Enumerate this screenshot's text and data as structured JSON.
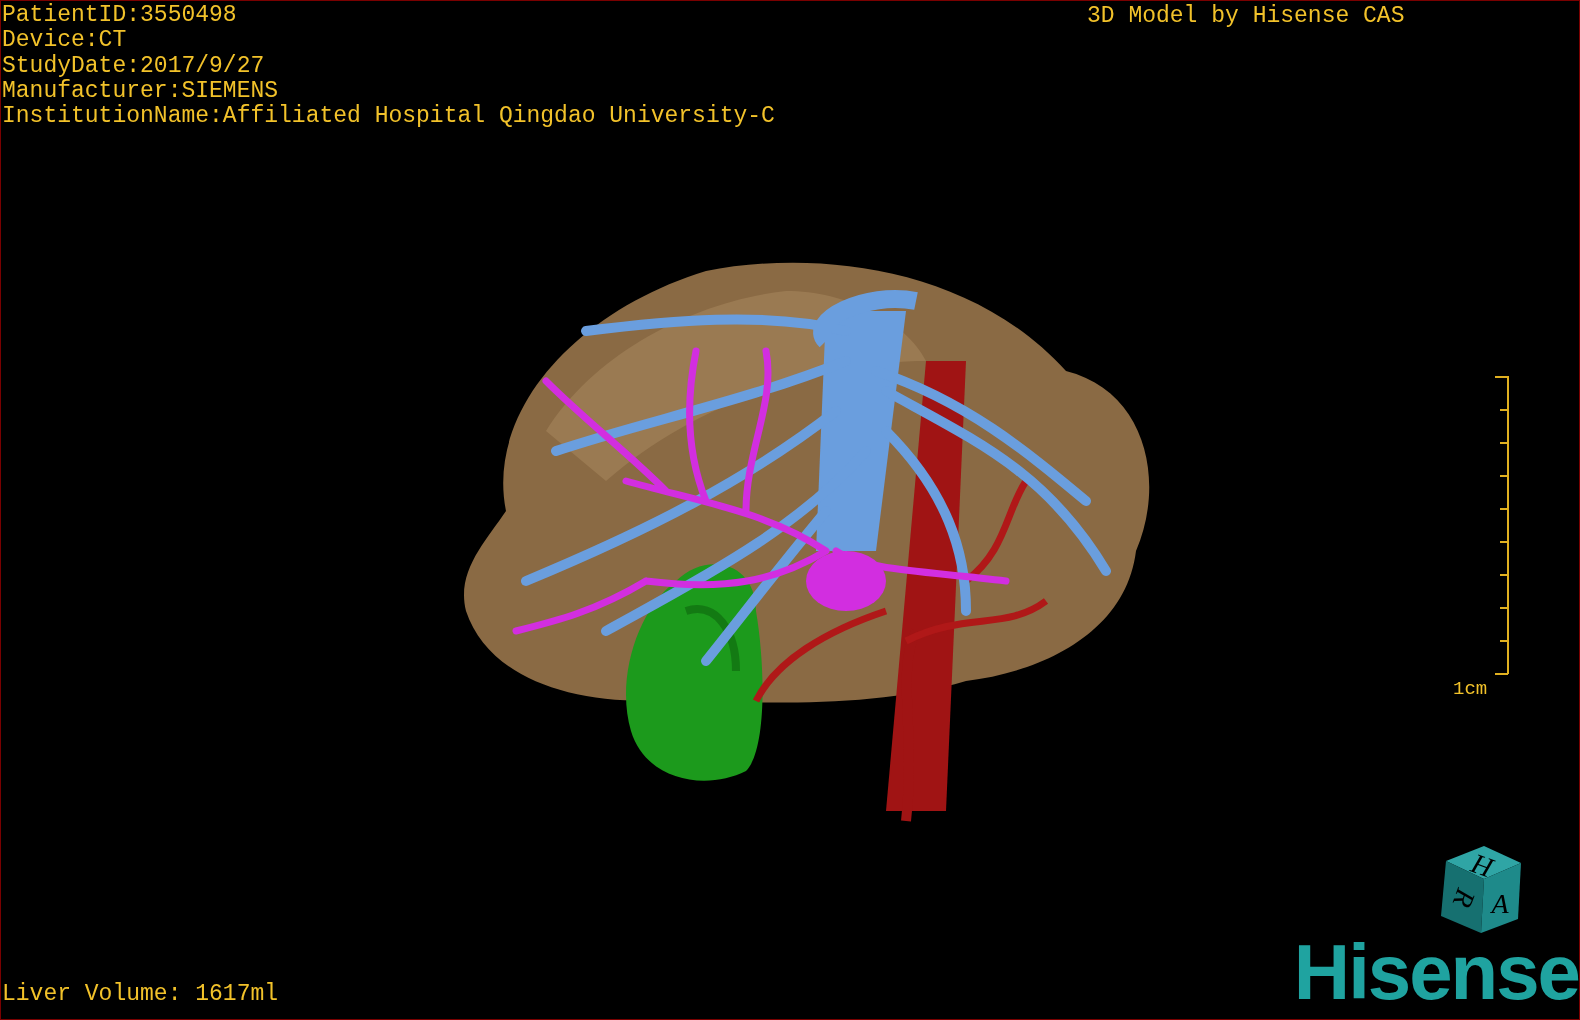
{
  "viewer": {
    "info_lines": [
      "PatientID:3550498",
      "Device:CT",
      "StudyDate:2017/9/27",
      "Manufacturer:SIEMENS",
      "InstitutionName:Affiliated Hospital Qingdao University-C"
    ],
    "title": "3D Model by Hisense CAS",
    "volume": "Liver Volume: 1617ml",
    "scale_bar": {
      "label": "1cm"
    },
    "orientation_cube": {
      "top": "H",
      "left": "R",
      "front": "A"
    },
    "logo": "Hisense"
  }
}
